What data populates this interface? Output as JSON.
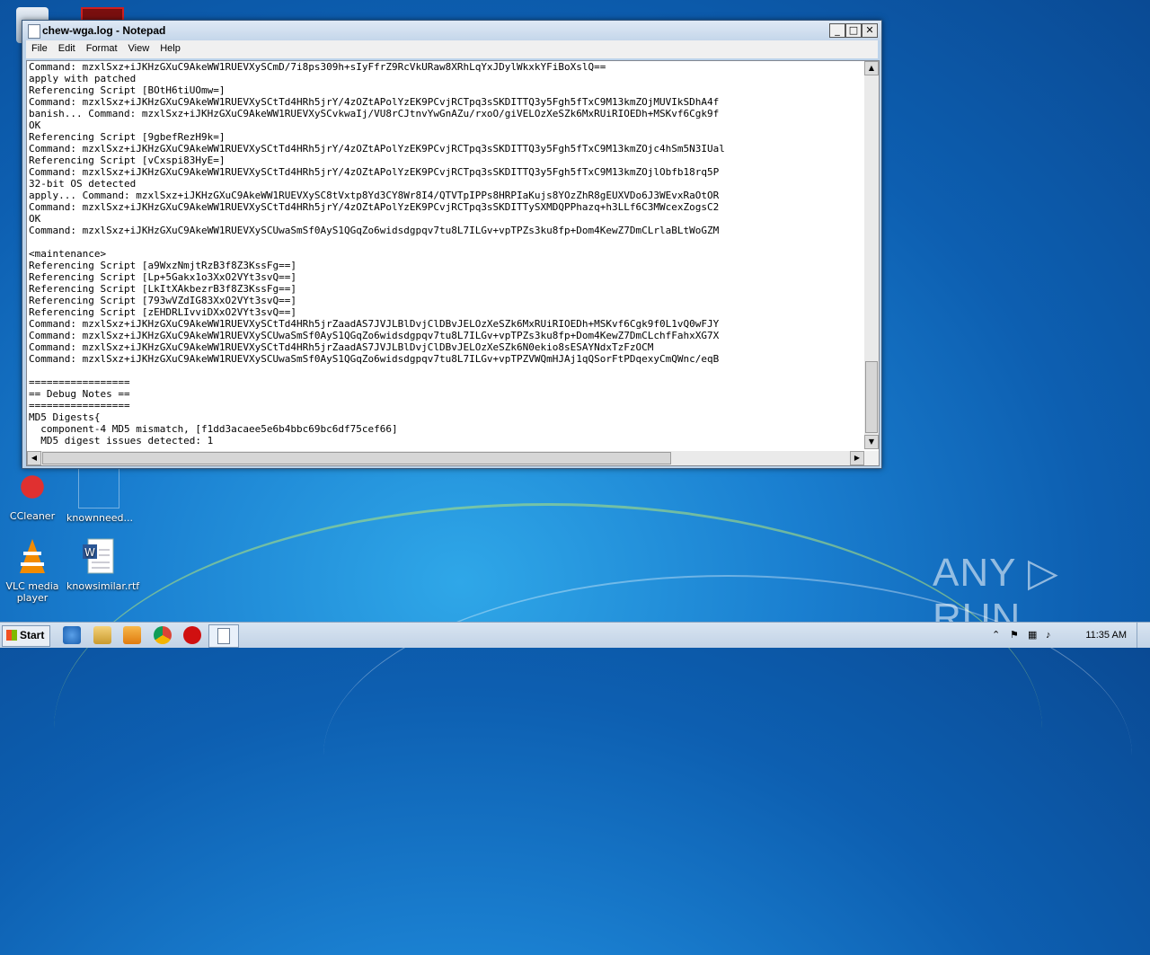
{
  "window": {
    "title": "chew-wga.log - Notepad",
    "minimize": "_",
    "maximize": "□",
    "close": "✕"
  },
  "menu": {
    "file": "File",
    "edit": "Edit",
    "format": "Format",
    "view": "View",
    "help": "Help"
  },
  "editor": {
    "content": "Command: mzxlSxz+iJKHzGXuC9AkeWW1RUEVXySCmD/7i8ps309h+sIyFfrZ9RcVkURaw8XRhLqYxJDylWkxkYFiBoXslQ==\napply with patched\nReferencing Script [BOtH6tiUOmw=]\nCommand: mzxlSxz+iJKHzGXuC9AkeWW1RUEVXySCtTd4HRh5jrY/4zOZtAPolYzEK9PCvjRCTpq3sSKDITTQ3y5Fgh5fTxC9M13kmZOjMUVIkSDhA4f\nbanish... Command: mzxlSxz+iJKHzGXuC9AkeWW1RUEVXySCvkwaIj/VU8rCJtnvYwGnAZu/rxoO/giVELOzXeSZk6MxRUiRIOEDh+MSKvf6Cgk9f\nOK\nReferencing Script [9gbefRezH9k=]\nCommand: mzxlSxz+iJKHzGXuC9AkeWW1RUEVXySCtTd4HRh5jrY/4zOZtAPolYzEK9PCvjRCTpq3sSKDITTQ3y5Fgh5fTxC9M13kmZOjc4hSm5N3IUal\nReferencing Script [vCxspi83HyE=]\nCommand: mzxlSxz+iJKHzGXuC9AkeWW1RUEVXySCtTd4HRh5jrY/4zOZtAPolYzEK9PCvjRCTpq3sSKDITTQ3y5Fgh5fTxC9M13kmZOjlObfb18rq5P\n32-bit OS detected\napply... Command: mzxlSxz+iJKHzGXuC9AkeWW1RUEVXySC8tVxtp8Yd3CY8Wr8I4/QTVTpIPPs8HRPIaKujs8YOzZhR8gEUXVDo6J3WEvxRaOtOR\nCommand: mzxlSxz+iJKHzGXuC9AkeWW1RUEVXySCtTd4HRh5jrY/4zOZtAPolYzEK9PCvjRCTpq3sSKDITTySXMDQPPhazq+h3LLf6C3MWcexZogsC2\nOK\nCommand: mzxlSxz+iJKHzGXuC9AkeWW1RUEVXySCUwaSmSf0AyS1QGqZo6widsdgpqv7tu8L7ILGv+vpTPZs3ku8fp+Dom4KewZ7DmCLrlaBLtWoGZM\n\n<maintenance>\nReferencing Script [a9WxzNmjtRzB3f8Z3KssFg==]\nReferencing Script [Lp+5Gakx1o3XxO2VYt3svQ==]\nReferencing Script [LkItXAkbezrB3f8Z3KssFg==]\nReferencing Script [793wVZdIG83XxO2VYt3svQ==]\nReferencing Script [zEHDRLIvviDXxO2VYt3svQ==]\nCommand: mzxlSxz+iJKHzGXuC9AkeWW1RUEVXySCtTd4HRh5jrZaadAS7JVJLBlDvjClDBvJELOzXeSZk6MxRUiRIOEDh+MSKvf6Cgk9f0L1vQ0wFJY\nCommand: mzxlSxz+iJKHzGXuC9AkeWW1RUEVXySCUwaSmSf0AyS1QGqZo6widsdgpqv7tu8L7ILGv+vpTPZs3ku8fp+Dom4KewZ7DmCLchfFahxXG7X\nCommand: mzxlSxz+iJKHzGXuC9AkeWW1RUEVXySCtTd4HRh5jrZaadAS7JVJLBlDvjClDBvJELOzXeSZk6N0ekio8sESAYNdxTzFzOCM\nCommand: mzxlSxz+iJKHzGXuC9AkeWW1RUEVXySCUwaSmSf0AyS1QGqZo6widsdgpqv7tu8L7ILGv+vpTPZVWQmHJAj1qQSorFtPDqexyCmQWnc/eqB\n\n=================\n== Debug Notes ==\n=================\nMD5 Digests{\n  component-4 MD5 mismatch, [f1dd3acaee5e6b4bbc69bc6df75cef66]\n  MD5 digest issues detected: 1"
  },
  "desktop": {
    "icons": [
      {
        "label": "CCleaner"
      },
      {
        "label": "knownneed..."
      },
      {
        "label": "VLC media player"
      },
      {
        "label": "knowsimilar.rtf"
      }
    ],
    "watermark": "ANY ▷ RUN"
  },
  "taskbar": {
    "start_label": "Start",
    "clock": "11:35 AM"
  }
}
